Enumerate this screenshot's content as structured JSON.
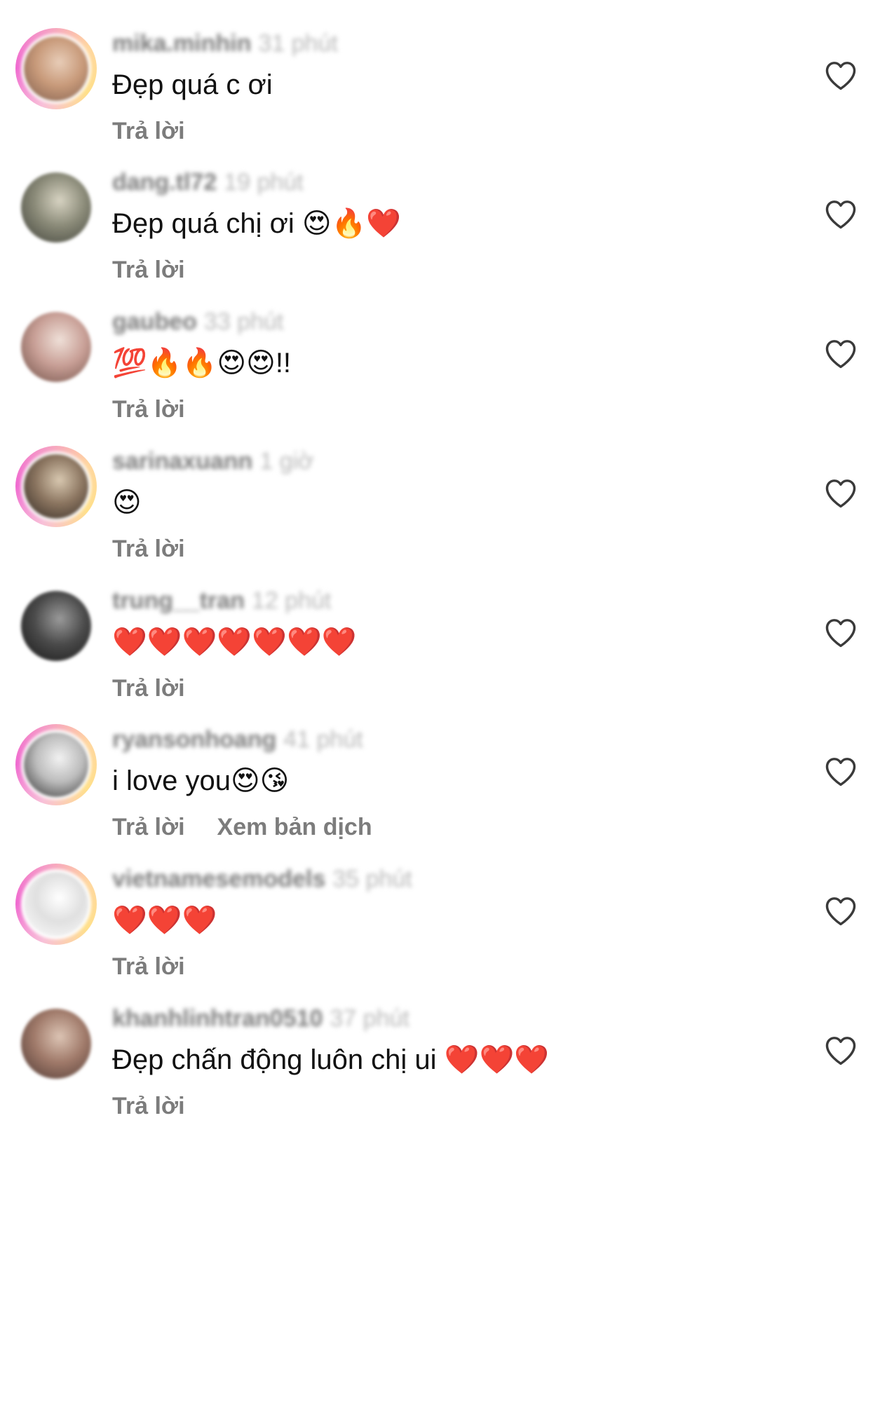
{
  "comments": [
    {
      "username": "mika.minhin",
      "time": "31 phút",
      "text": "Đẹp quá c ơi",
      "actions": [
        "Trả lời"
      ],
      "avatar": {
        "ring": true,
        "colors": [
          "#7b5a4a",
          "#c89a7a",
          "#e8cdb8"
        ]
      }
    },
    {
      "username": "dang.tl72",
      "time": "19 phút",
      "text": "Đẹp quá chị ơi 😍🔥❤️",
      "actions": [
        "Trả lời"
      ],
      "avatar": {
        "ring": false,
        "colors": [
          "#3d3f38",
          "#8a8a78",
          "#d7d3c2"
        ]
      }
    },
    {
      "username": "gaubeo",
      "time": "33 phút",
      "text": "💯🔥🔥😍😍!!",
      "actions": [
        "Trả lời"
      ],
      "avatar": {
        "ring": false,
        "colors": [
          "#6b4b42",
          "#c89f96",
          "#efe0d8"
        ]
      }
    },
    {
      "username": "sarinaxuann",
      "time": "1 giờ",
      "text": "😍",
      "actions": [
        "Trả lời"
      ],
      "avatar": {
        "ring": true,
        "colors": [
          "#2e2620",
          "#8b7560",
          "#d8c8b0"
        ]
      }
    },
    {
      "username": "trung__tran",
      "time": "12 phút",
      "text": "❤️❤️❤️❤️❤️❤️❤️",
      "actions": [
        "Trả lời"
      ],
      "avatar": {
        "ring": false,
        "colors": [
          "#141414",
          "#4a4a4a",
          "#9a9a9a"
        ]
      }
    },
    {
      "username": "ryansonhoang",
      "time": "41 phút",
      "text": "i love you😍😘",
      "actions": [
        "Trả lời",
        "Xem bản dịch"
      ],
      "avatar": {
        "ring": true,
        "colors": [
          "#2a2a2a",
          "#bcbcbc",
          "#f2f2f2"
        ]
      }
    },
    {
      "username": "vietnamesemodels",
      "time": "35 phút",
      "text": "❤️❤️❤️",
      "actions": [
        "Trả lời"
      ],
      "avatar": {
        "ring": true,
        "colors": [
          "#ffffff",
          "#e0e0e0",
          "#ffffff"
        ]
      }
    },
    {
      "username": "khanhlinhtran0510",
      "time": "37 phút",
      "text": "Đẹp chấn động luôn chị ui ❤️❤️❤️",
      "actions": [
        "Trả lời"
      ],
      "avatar": {
        "ring": false,
        "colors": [
          "#4a3530",
          "#a07a6a",
          "#dcc4b4"
        ]
      }
    }
  ],
  "icons": {
    "like": "heart-outline-icon"
  },
  "colors": {
    "text": "#111111",
    "secondary": "#7c7c7c",
    "muted": "#b8b8b8",
    "icon": "#3a3a3a"
  }
}
